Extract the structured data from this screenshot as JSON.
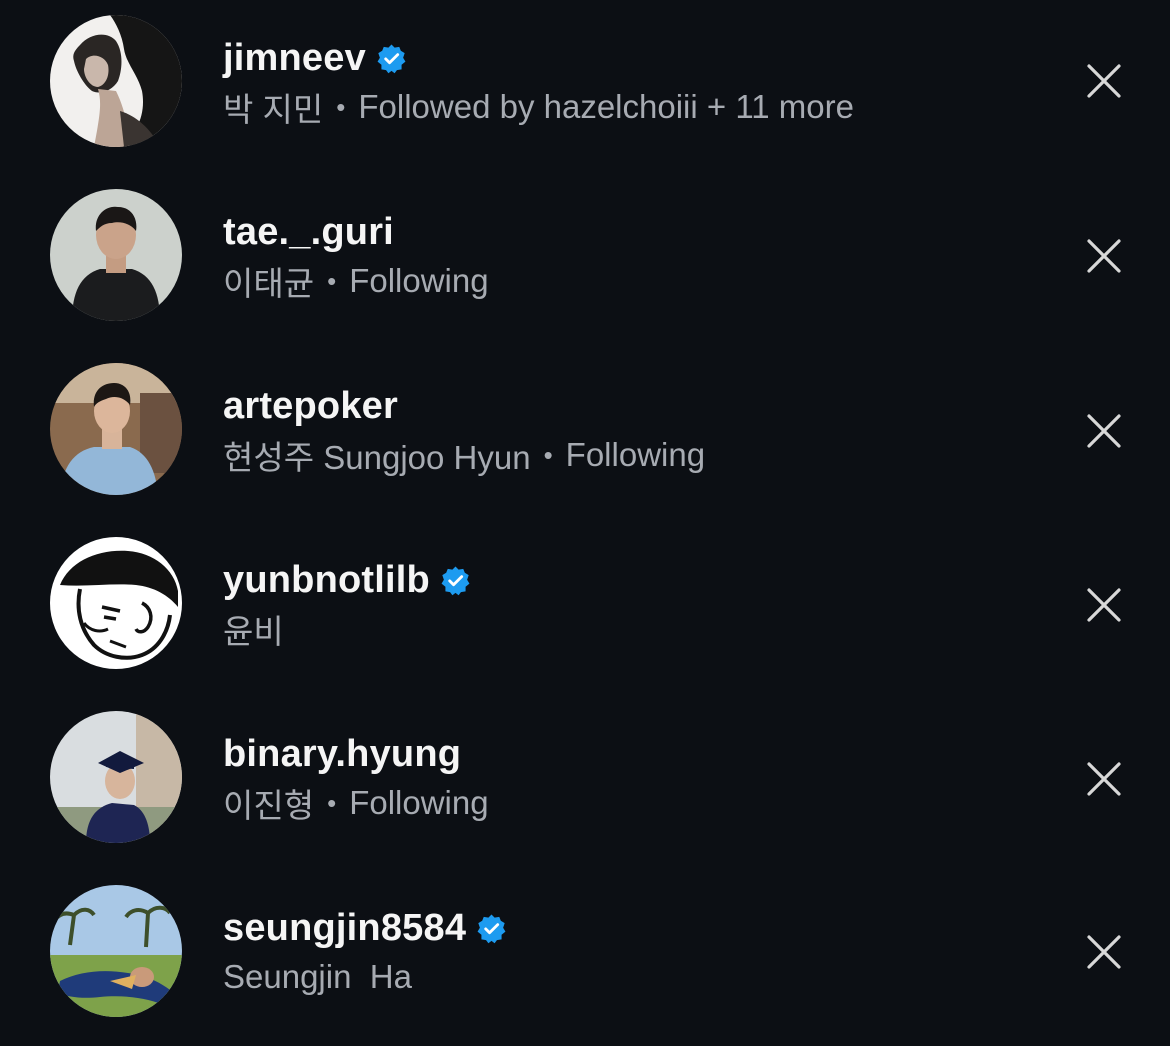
{
  "colors": {
    "background": "#0c0f14",
    "username": "#f5f5f5",
    "subtitle": "#a7abb2",
    "verified_badge": "#1d9bf0",
    "close_icon": "#d8d8d8"
  },
  "suggestions": [
    {
      "username": "jimneev",
      "verified": true,
      "full_name": "박 지민",
      "status": "Followed by hazelchoiii + 11 more",
      "avatar_icon": "avatar-woman-profile-photo",
      "dismiss_icon": "close-icon"
    },
    {
      "username": "tae._.guri",
      "verified": false,
      "full_name": "이태균",
      "status": "Following",
      "avatar_icon": "avatar-man-black-shirt-photo",
      "dismiss_icon": "close-icon"
    },
    {
      "username": "artepoker",
      "verified": false,
      "full_name": "현성주 Sungjoo Hyun",
      "status": "Following",
      "avatar_icon": "avatar-man-blue-sweater-photo",
      "dismiss_icon": "close-icon"
    },
    {
      "username": "yunbnotlilb",
      "verified": true,
      "full_name": "윤비",
      "status": "",
      "avatar_icon": "avatar-cartoon-sketch",
      "dismiss_icon": "close-icon"
    },
    {
      "username": "binary.hyung",
      "verified": false,
      "full_name": "이진형",
      "status": "Following",
      "avatar_icon": "avatar-graduation-photo",
      "dismiss_icon": "close-icon"
    },
    {
      "username": "seungjin8584",
      "verified": true,
      "full_name": "Seungjin  Ha",
      "status": "",
      "avatar_icon": "avatar-outdoor-lying-photo",
      "dismiss_icon": "close-icon"
    }
  ]
}
